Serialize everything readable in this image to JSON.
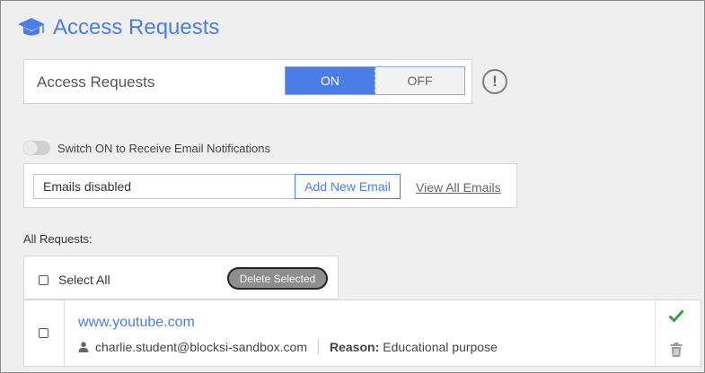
{
  "header": {
    "title": "Access Requests",
    "icon": "graduation-cap-icon"
  },
  "access_card": {
    "label": "Access Requests",
    "toggle": {
      "on_label": "ON",
      "off_label": "OFF",
      "selected": "ON"
    },
    "info_icon": "exclamation-icon",
    "info_glyph": "!"
  },
  "notifications": {
    "switch_label": "Switch ON to Receive Email Notifications",
    "enabled": false
  },
  "emails": {
    "input_value": "Emails disabled",
    "add_button": "Add New Email",
    "view_all_link": "View All Emails"
  },
  "requests": {
    "section_label": "All Requests:",
    "select_all_label": "Select All",
    "delete_selected_label": "Delete Selected",
    "items": [
      {
        "url": "www.youtube.com",
        "user": "charlie.student@blocksi-sandbox.com",
        "reason_label": "Reason:",
        "reason": "Educational purpose"
      }
    ]
  },
  "colors": {
    "accent": "#4a7de8",
    "approve": "#3aa03a",
    "trash": "#9a9a9a"
  }
}
